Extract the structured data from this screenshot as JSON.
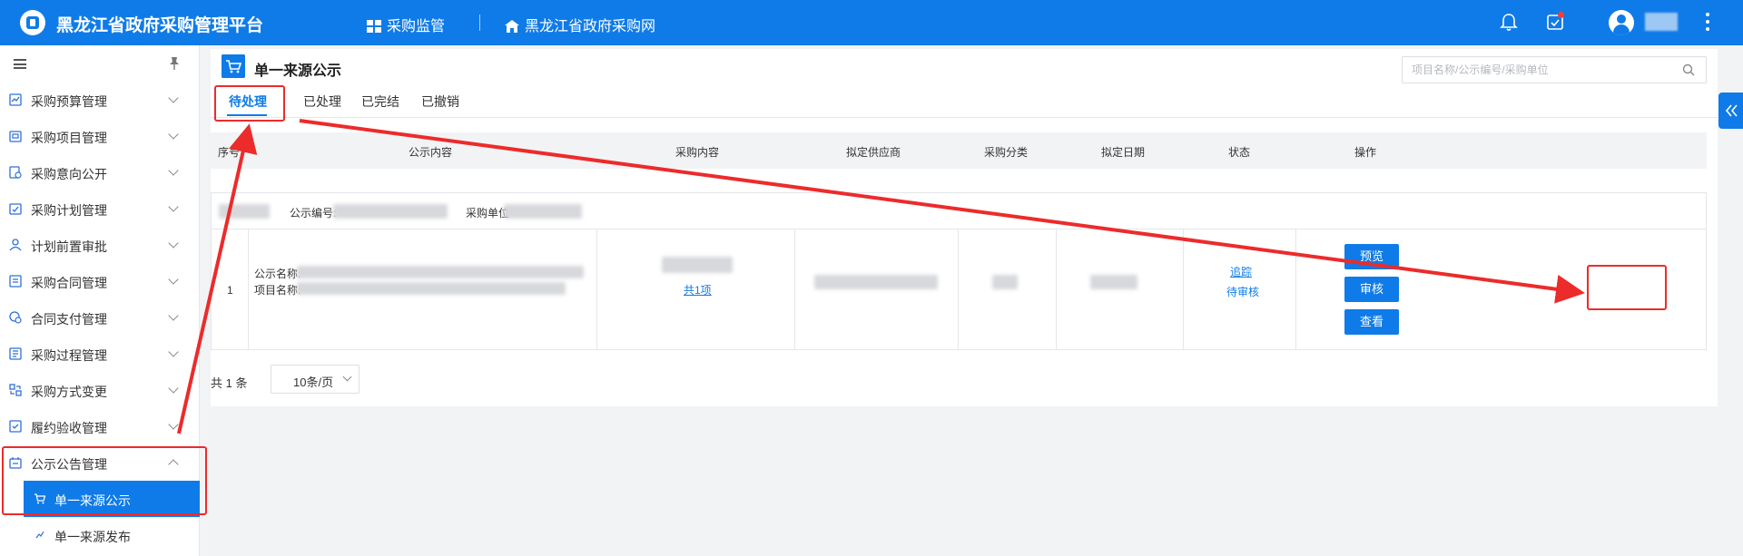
{
  "header": {
    "app_title": "黑龙江省政府采购管理平台",
    "nav": [
      {
        "label": "采购监管",
        "icon": "grid-icon"
      },
      {
        "label": "黑龙江省政府采购网",
        "icon": "home-icon"
      }
    ],
    "icons": [
      "bell-icon",
      "task-check-icon",
      "avatar-icon",
      "more-vertical-icon"
    ],
    "colors": {
      "primary": "#0f7be8",
      "highlight": "#ec2b2b"
    }
  },
  "sidebar": {
    "items": [
      {
        "label": "采购预算管理",
        "icon": "budget-icon"
      },
      {
        "label": "采购项目管理",
        "icon": "project-icon"
      },
      {
        "label": "采购意向公开",
        "icon": "intent-icon"
      },
      {
        "label": "采购计划管理",
        "icon": "plan-icon"
      },
      {
        "label": "计划前置审批",
        "icon": "approval-icon"
      },
      {
        "label": "采购合同管理",
        "icon": "contract-icon"
      },
      {
        "label": "合同支付管理",
        "icon": "payment-icon"
      },
      {
        "label": "采购过程管理",
        "icon": "process-icon"
      },
      {
        "label": "采购方式变更",
        "icon": "method-change-icon"
      },
      {
        "label": "履约验收管理",
        "icon": "acceptance-icon"
      },
      {
        "label": "公示公告管理",
        "icon": "announcement-icon"
      }
    ],
    "sub_items": [
      {
        "label": "单一来源公示",
        "icon": "cart-icon",
        "active": true
      },
      {
        "label": "单一来源发布",
        "icon": "publish-icon",
        "active": false
      }
    ]
  },
  "page": {
    "title": "单一来源公示",
    "search_placeholder": "项目名称/公示编号/采购单位",
    "tabs": [
      "待处理",
      "已处理",
      "已完结",
      "已撤销"
    ],
    "active_tab": "待处理",
    "columns": [
      "序号",
      "公示内容",
      "采购内容",
      "拟定供应商",
      "采购分类",
      "拟定日期",
      "状态",
      "操作"
    ],
    "record": {
      "meta_labels": {
        "code": "公示编号:",
        "unit": "采购单位"
      },
      "index": "1",
      "name_labels": {
        "announce": "公示名称:",
        "project": "项目名称:"
      },
      "content_link": "共1项",
      "status_link": "追踪",
      "status_text": "待审核",
      "buttons": [
        "预览",
        "审核",
        "查看"
      ]
    },
    "pager": {
      "total": "共 1 条",
      "page_size": "10条/页"
    }
  }
}
